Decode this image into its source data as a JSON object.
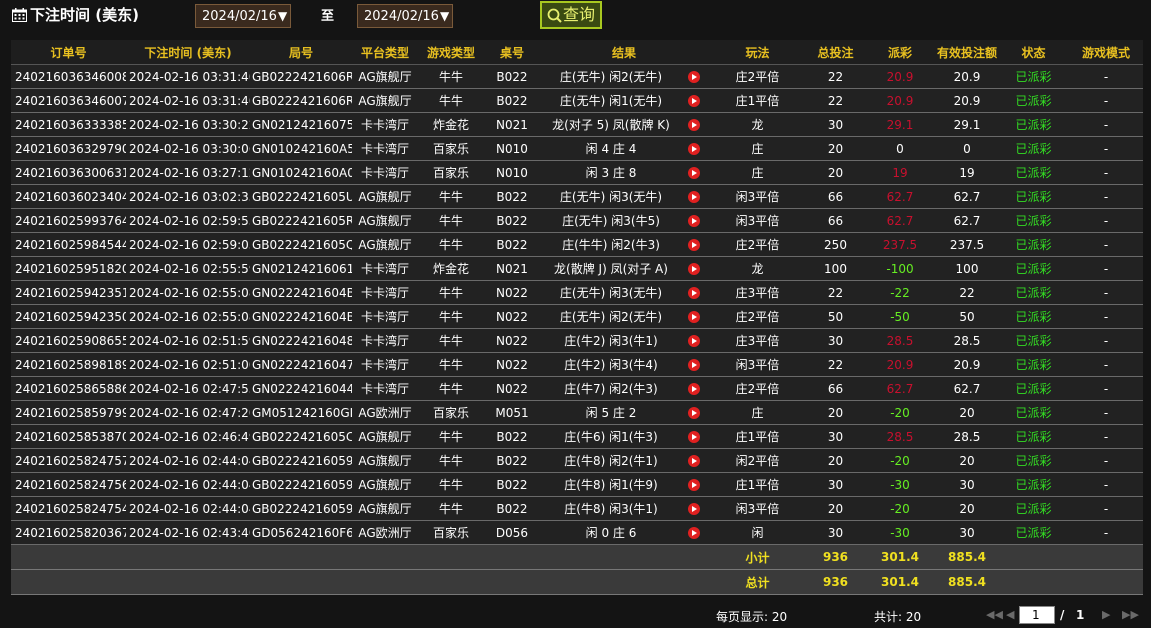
{
  "filter": {
    "label": "下注时间 (美东)",
    "date_from": "2024/02/16",
    "to_label": "至",
    "date_to": "2024/02/16",
    "query_label": "查询"
  },
  "columns": [
    "订单号",
    "下注时间 (美东)",
    "局号",
    "平台类型",
    "游戏类型",
    "桌号",
    "结果",
    "玩法",
    "总投注",
    "派彩",
    "有效投注额",
    "状态",
    "游戏模式"
  ],
  "rows": [
    {
      "order": "240216036346008",
      "time": "2024-02-16 03:31:40",
      "round": "GB0222421606R",
      "platform": "AG旗舰厅",
      "game": "牛牛",
      "table": "B022",
      "result": "庄(无牛) 闲2(无牛)",
      "play": "庄2平倍",
      "bet": "22",
      "payout": "20.9",
      "valid": "20.9",
      "status": "已派彩",
      "mode": "-"
    },
    {
      "order": "240216036346007",
      "time": "2024-02-16 03:31:40",
      "round": "GB0222421606R",
      "platform": "AG旗舰厅",
      "game": "牛牛",
      "table": "B022",
      "result": "庄(无牛) 闲1(无牛)",
      "play": "庄1平倍",
      "bet": "22",
      "payout": "20.9",
      "valid": "20.9",
      "status": "已派彩",
      "mode": "-"
    },
    {
      "order": "240216036333385",
      "time": "2024-02-16 03:30:22",
      "round": "GN02124216075",
      "platform": "卡卡湾厅",
      "game": "炸金花",
      "table": "N021",
      "result": "龙(对子 5) 凤(散牌 K)",
      "play": "龙",
      "bet": "30",
      "payout": "29.1",
      "valid": "29.1",
      "status": "已派彩",
      "mode": "-"
    },
    {
      "order": "240216036329790",
      "time": "2024-02-16 03:30:06",
      "round": "GN010242160A5",
      "platform": "卡卡湾厅",
      "game": "百家乐",
      "table": "N010",
      "result": "闲 4 庄 4",
      "play": "庄",
      "bet": "20",
      "payout": "0",
      "valid": "0",
      "status": "已派彩",
      "mode": "-"
    },
    {
      "order": "240216036300631",
      "time": "2024-02-16 03:27:12",
      "round": "GN010242160A0",
      "platform": "卡卡湾厅",
      "game": "百家乐",
      "table": "N010",
      "result": "闲 3 庄 8",
      "play": "庄",
      "bet": "20",
      "payout": "19",
      "valid": "19",
      "status": "已派彩",
      "mode": "-"
    },
    {
      "order": "240216036023404",
      "time": "2024-02-16 03:02:35",
      "round": "GB0222421605U",
      "platform": "AG旗舰厅",
      "game": "牛牛",
      "table": "B022",
      "result": "庄(无牛) 闲3(无牛)",
      "play": "闲3平倍",
      "bet": "66",
      "payout": "62.7",
      "valid": "62.7",
      "status": "已派彩",
      "mode": "-"
    },
    {
      "order": "240216025993764",
      "time": "2024-02-16 02:59:53",
      "round": "GB0222421605R",
      "platform": "AG旗舰厅",
      "game": "牛牛",
      "table": "B022",
      "result": "庄(无牛) 闲3(牛5)",
      "play": "闲3平倍",
      "bet": "66",
      "payout": "62.7",
      "valid": "62.7",
      "status": "已派彩",
      "mode": "-"
    },
    {
      "order": "240216025984544",
      "time": "2024-02-16 02:59:03",
      "round": "GB0222421605Q",
      "platform": "AG旗舰厅",
      "game": "牛牛",
      "table": "B022",
      "result": "庄(牛牛) 闲2(牛3)",
      "play": "庄2平倍",
      "bet": "250",
      "payout": "237.5",
      "valid": "237.5",
      "status": "已派彩",
      "mode": "-"
    },
    {
      "order": "240216025951820",
      "time": "2024-02-16 02:55:59",
      "round": "GN02124216061",
      "platform": "卡卡湾厅",
      "game": "炸金花",
      "table": "N021",
      "result": "龙(散牌 J) 凤(对子 A)",
      "play": "龙",
      "bet": "100",
      "payout": "-100",
      "valid": "100",
      "status": "已派彩",
      "mode": "-"
    },
    {
      "order": "240216025942351",
      "time": "2024-02-16 02:55:08",
      "round": "GN0222421604B",
      "platform": "卡卡湾厅",
      "game": "牛牛",
      "table": "N022",
      "result": "庄(无牛) 闲3(无牛)",
      "play": "庄3平倍",
      "bet": "22",
      "payout": "-22",
      "valid": "22",
      "status": "已派彩",
      "mode": "-"
    },
    {
      "order": "240216025942350",
      "time": "2024-02-16 02:55:08",
      "round": "GN0222421604B",
      "platform": "卡卡湾厅",
      "game": "牛牛",
      "table": "N022",
      "result": "庄(无牛) 闲2(无牛)",
      "play": "庄2平倍",
      "bet": "50",
      "payout": "-50",
      "valid": "50",
      "status": "已派彩",
      "mode": "-"
    },
    {
      "order": "240216025908655",
      "time": "2024-02-16 02:51:59",
      "round": "GN02224216048",
      "platform": "卡卡湾厅",
      "game": "牛牛",
      "table": "N022",
      "result": "庄(牛2) 闲3(牛1)",
      "play": "庄3平倍",
      "bet": "30",
      "payout": "28.5",
      "valid": "28.5",
      "status": "已派彩",
      "mode": "-"
    },
    {
      "order": "240216025898189",
      "time": "2024-02-16 02:51:00",
      "round": "GN02224216047",
      "platform": "卡卡湾厅",
      "game": "牛牛",
      "table": "N022",
      "result": "庄(牛2) 闲3(牛4)",
      "play": "闲3平倍",
      "bet": "22",
      "payout": "20.9",
      "valid": "20.9",
      "status": "已派彩",
      "mode": "-"
    },
    {
      "order": "240216025865886",
      "time": "2024-02-16 02:47:55",
      "round": "GN02224216044",
      "platform": "卡卡湾厅",
      "game": "牛牛",
      "table": "N022",
      "result": "庄(牛7) 闲2(牛3)",
      "play": "庄2平倍",
      "bet": "66",
      "payout": "62.7",
      "valid": "62.7",
      "status": "已派彩",
      "mode": "-"
    },
    {
      "order": "240216025859799",
      "time": "2024-02-16 02:47:20",
      "round": "GM051242160GL",
      "platform": "AG欧洲厅",
      "game": "百家乐",
      "table": "M051",
      "result": "闲 5 庄 2",
      "play": "庄",
      "bet": "20",
      "payout": "-20",
      "valid": "20",
      "status": "已派彩",
      "mode": "-"
    },
    {
      "order": "240216025853870",
      "time": "2024-02-16 02:46:49",
      "round": "GB0222421605C",
      "platform": "AG旗舰厅",
      "game": "牛牛",
      "table": "B022",
      "result": "庄(牛6) 闲1(牛3)",
      "play": "庄1平倍",
      "bet": "30",
      "payout": "28.5",
      "valid": "28.5",
      "status": "已派彩",
      "mode": "-"
    },
    {
      "order": "240216025824757",
      "time": "2024-02-16 02:44:04",
      "round": "GB02224216059",
      "platform": "AG旗舰厅",
      "game": "牛牛",
      "table": "B022",
      "result": "庄(牛8) 闲2(牛1)",
      "play": "闲2平倍",
      "bet": "20",
      "payout": "-20",
      "valid": "20",
      "status": "已派彩",
      "mode": "-"
    },
    {
      "order": "240216025824756",
      "time": "2024-02-16 02:44:04",
      "round": "GB02224216059",
      "platform": "AG旗舰厅",
      "game": "牛牛",
      "table": "B022",
      "result": "庄(牛8) 闲1(牛9)",
      "play": "庄1平倍",
      "bet": "30",
      "payout": "-30",
      "valid": "30",
      "status": "已派彩",
      "mode": "-"
    },
    {
      "order": "240216025824754",
      "time": "2024-02-16 02:44:04",
      "round": "GB02224216059",
      "platform": "AG旗舰厅",
      "game": "牛牛",
      "table": "B022",
      "result": "庄(牛8) 闲3(牛1)",
      "play": "闲3平倍",
      "bet": "20",
      "payout": "-20",
      "valid": "20",
      "status": "已派彩",
      "mode": "-"
    },
    {
      "order": "240216025820367",
      "time": "2024-02-16 02:43:40",
      "round": "GD056242160F6",
      "platform": "AG欧洲厅",
      "game": "百家乐",
      "table": "D056",
      "result": "闲 0 庄 6",
      "play": "闲",
      "bet": "30",
      "payout": "-30",
      "valid": "30",
      "status": "已派彩",
      "mode": "-"
    }
  ],
  "subtotal": {
    "label": "小计",
    "bet": "936",
    "payout": "301.4",
    "valid": "885.4"
  },
  "grand_total": {
    "label": "总计",
    "bet": "936",
    "payout": "301.4",
    "valid": "885.4"
  },
  "pagination": {
    "per_page_text": "每页显示: 20",
    "total_text": "共计: 20",
    "current_page": "1",
    "separator": "/",
    "total_pages": "1"
  },
  "colors": {
    "header_text": "#e8c020",
    "payout_positive": "#c8102e",
    "payout_negative": "#66ee22",
    "status_paid": "#33dd22",
    "sum_text": "#f0e020",
    "play_icon": "#e02020"
  },
  "icons": {
    "filter": "calendar-icon",
    "query": "search-icon",
    "result": "play-icon",
    "pager": [
      "first-page-icon",
      "prev-page-icon",
      "next-page-icon",
      "last-page-icon"
    ]
  }
}
